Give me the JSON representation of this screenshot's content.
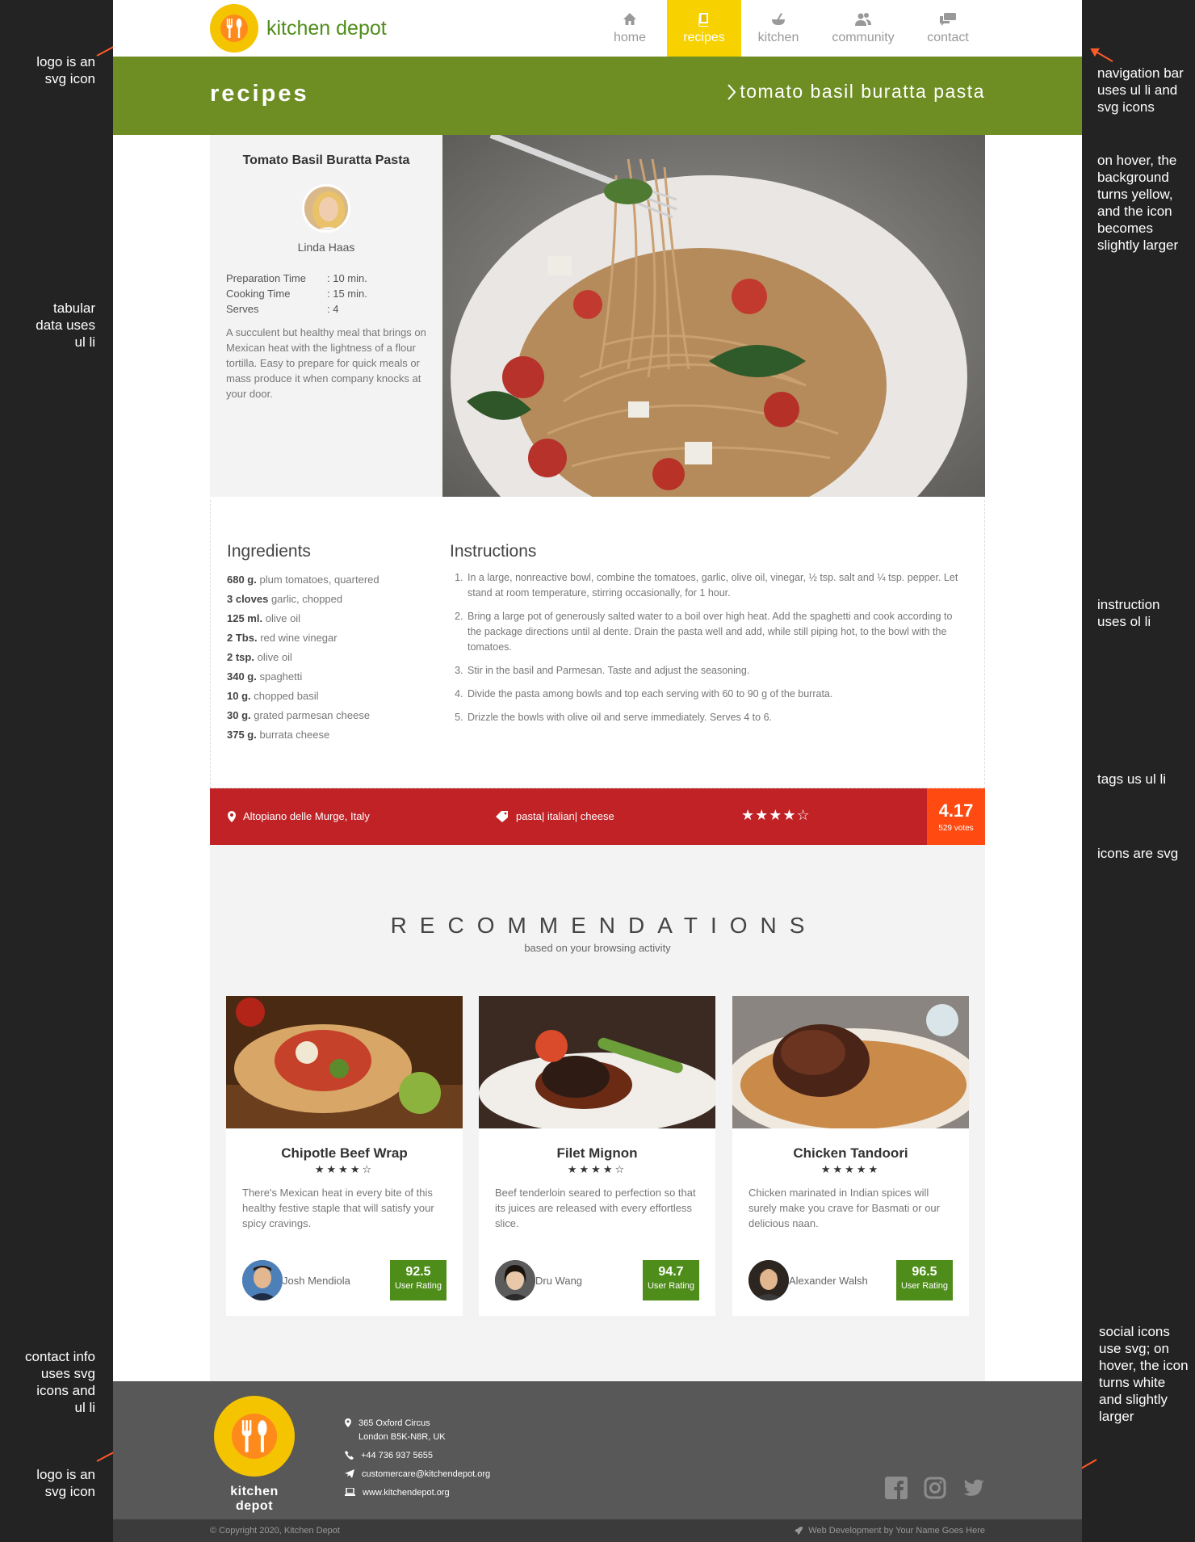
{
  "annotations": {
    "logo_top": "logo is an svg icon",
    "tabular": "tabular data uses ul li",
    "nav": "navigation bar uses ul li and svg icons",
    "hover": "on hover, the background turns yellow, and the icon becomes slightly larger",
    "instruction": "instruction uses ol li",
    "tags": "tags us ul li",
    "icons": "icons are svg",
    "contact": "contact info uses svg icons and ul li",
    "logo_bottom": "logo is an svg icon",
    "social": "social icons use svg; on hover, the icon turns white and slightly larger"
  },
  "brand": {
    "name": "kitchen depot",
    "logo_color": "#f5c400",
    "green": "#4f8d1a"
  },
  "nav": [
    {
      "label": "home",
      "icon": "home-icon"
    },
    {
      "label": "recipes",
      "icon": "book-icon",
      "active": true
    },
    {
      "label": "kitchen",
      "icon": "bowl-icon"
    },
    {
      "label": "community",
      "icon": "people-icon"
    },
    {
      "label": "contact",
      "icon": "chat-icon"
    }
  ],
  "banner": {
    "title": "recipes",
    "breadcrumb": "tomato basil buratta pasta"
  },
  "recipe": {
    "title": "Tomato Basil Buratta Pasta",
    "author": "Linda Haas",
    "facts": [
      {
        "k": "Preparation Time",
        "v": ": 10 min."
      },
      {
        "k": "Cooking Time",
        "v": ": 15 min."
      },
      {
        "k": "Serves",
        "v": ": 4"
      }
    ],
    "description": "A succulent but healthy meal that brings on Mexican heat with the lightness of a flour tortilla. Easy to prepare for quick meals or mass produce it when company knocks at your door."
  },
  "ingredients": {
    "heading": "Ingredients",
    "items": [
      {
        "q": "680 g.",
        "t": "plum tomatoes, quartered"
      },
      {
        "q": "3 cloves",
        "t": "garlic, chopped"
      },
      {
        "q": "125 ml.",
        "t": "olive oil"
      },
      {
        "q": "2 Tbs.",
        "t": "red wine vinegar"
      },
      {
        "q": "2 tsp.",
        "t": "olive oil"
      },
      {
        "q": "340 g.",
        "t": "spaghetti"
      },
      {
        "q": "10 g.",
        "t": "chopped basil"
      },
      {
        "q": "30 g.",
        "t": "grated parmesan cheese"
      },
      {
        "q": "375 g.",
        "t": "burrata cheese"
      }
    ]
  },
  "instructions": {
    "heading": "Instructions",
    "steps": [
      "In a large, nonreactive bowl, combine the tomatoes, garlic, olive oil, vinegar, ½ tsp. salt and ¼ tsp. pepper. Let stand at room temperature, stirring occasionally, for 1 hour.",
      "Bring a large pot of generously salted water to a boil over high heat. Add the spaghetti and cook according to the package directions until al dente. Drain the pasta well and add, while still piping hot, to the bowl with the tomatoes.",
      "Stir in the basil and Parmesan. Taste and adjust the seasoning.",
      "Divide the pasta among bowls and top each serving with 60 to 90 g of the burrata.",
      "Drizzle the bowls with olive oil and serve immediately. Serves 4 to 6."
    ]
  },
  "tags_bar": {
    "location": "Altopiano delle Murge, Italy",
    "tags": [
      "pasta",
      "italian",
      "cheese"
    ],
    "stars": "★★★★☆",
    "score": "4.17",
    "votes": "529 votes"
  },
  "recommendations": {
    "heading": "RECOMMENDATIONS",
    "subheading": "based on your browsing activity",
    "cards": [
      {
        "name": "Chipotle Beef Wrap",
        "stars": "★★★★☆",
        "desc": "There's Mexican heat in every bite of this healthy festive staple that will satisfy your spicy cravings.",
        "user": "Josh Mendiola",
        "rating": "92.5",
        "rating_label": "User Rating"
      },
      {
        "name": "Filet Mignon",
        "stars": "★★★★☆",
        "desc": "Beef tenderloin seared to perfection so that its juices are released with every effortless slice.",
        "user": "Dru Wang",
        "rating": "94.7",
        "rating_label": "User Rating"
      },
      {
        "name": "Chicken Tandoori",
        "stars": "★★★★★",
        "desc": "Chicken marinated in Indian spices will surely make you crave for Basmati or our delicious naan.",
        "user": "Alexander Walsh",
        "rating": "96.5",
        "rating_label": "User Rating"
      }
    ]
  },
  "footer": {
    "address1": "365 Oxford Circus",
    "address2": "London B5K-N8R, UK",
    "phone": "+44 736 937 5655",
    "email": "customercare@kitchendepot.org",
    "web": "www.kitchendepot.org",
    "copyright": "© Copyright 2020, Kitchen Depot",
    "credit": "Web Development by Your Name Goes Here"
  }
}
